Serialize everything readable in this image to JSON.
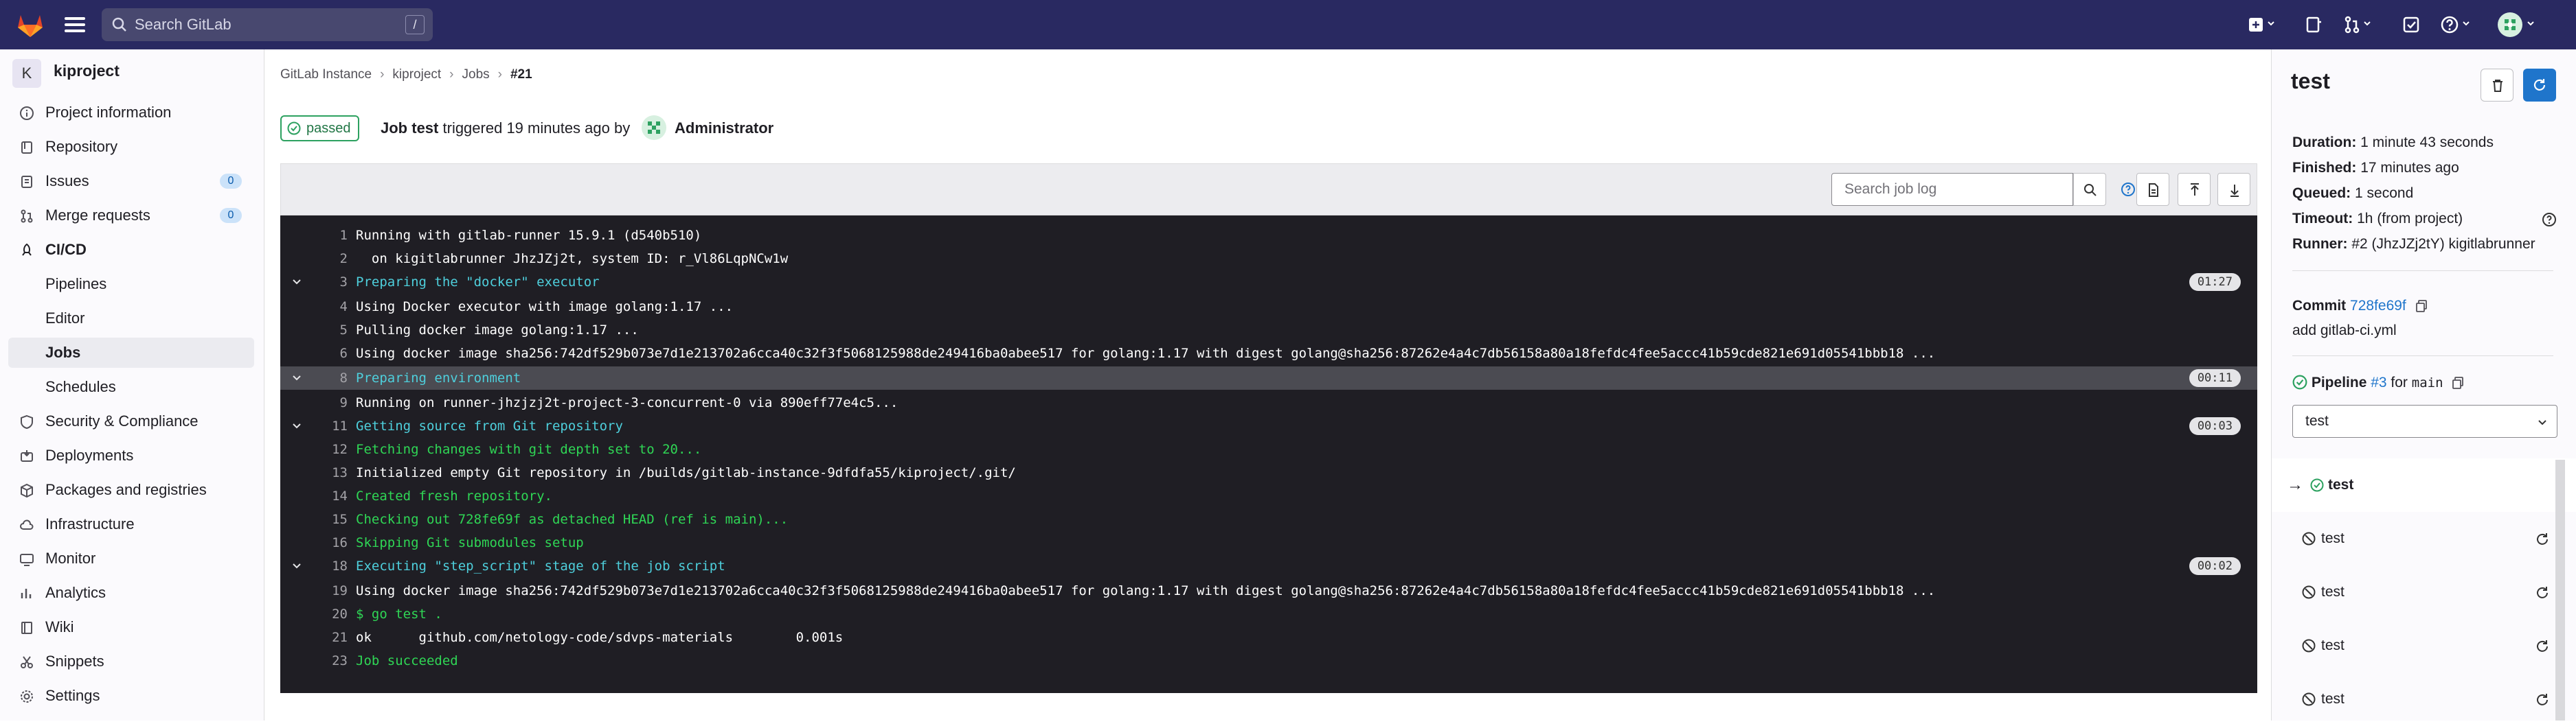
{
  "topbar": {
    "search_placeholder": "Search GitLab",
    "search_shortcut": "/"
  },
  "sidebar": {
    "project_initial": "K",
    "project_name": "kiproject",
    "items": [
      {
        "label": "Project information",
        "icon": "info-icon"
      },
      {
        "label": "Repository",
        "icon": "repository-icon"
      },
      {
        "label": "Issues",
        "icon": "issues-icon",
        "count": "0"
      },
      {
        "label": "Merge requests",
        "icon": "merge-request-icon",
        "count": "0"
      },
      {
        "label": "CI/CD",
        "icon": "rocket-icon"
      },
      {
        "label": "Security & Compliance",
        "icon": "shield-icon"
      },
      {
        "label": "Deployments",
        "icon": "deployments-icon"
      },
      {
        "label": "Packages and registries",
        "icon": "package-icon"
      },
      {
        "label": "Infrastructure",
        "icon": "cloud-icon"
      },
      {
        "label": "Monitor",
        "icon": "monitor-icon"
      },
      {
        "label": "Analytics",
        "icon": "chart-icon"
      },
      {
        "label": "Wiki",
        "icon": "book-icon"
      },
      {
        "label": "Snippets",
        "icon": "snippet-icon"
      },
      {
        "label": "Settings",
        "icon": "gear-icon"
      }
    ],
    "cicd_sub": [
      "Pipelines",
      "Editor",
      "Jobs",
      "Schedules"
    ]
  },
  "breadcrumb": [
    "GitLab Instance",
    "kiproject",
    "Jobs",
    "#21"
  ],
  "job": {
    "status": "passed",
    "headline_prefix": "Job",
    "job_name": "test",
    "triggered": "triggered 19 minutes ago by",
    "user": "Administrator"
  },
  "log_toolbar": {
    "search_placeholder": "Search job log"
  },
  "log": [
    {
      "n": "1",
      "t": "Running with gitlab-runner 15.9.1 (d540b510)",
      "c": ""
    },
    {
      "n": "2",
      "t": "  on kigitlabrunner JhzJZj2t, system ID: r_Vl86LqpNCw1w",
      "c": ""
    },
    {
      "n": "3",
      "t": "Preparing the \"docker\" executor",
      "c": "sec",
      "d": "01:27"
    },
    {
      "n": "4",
      "t": "Using Docker executor with image golang:1.17 ...",
      "c": ""
    },
    {
      "n": "5",
      "t": "Pulling docker image golang:1.17 ...",
      "c": ""
    },
    {
      "n": "6",
      "t": "Using docker image sha256:742df529b073e7d1e213702a6cca40c32f3f5068125988de249416ba0abee517 for golang:1.17 with digest golang@sha256:87262e4a4c7db56158a80a18fefdc4fee5accc41b59cde821e691d05541bbb18 ...",
      "c": ""
    },
    {
      "n": "8",
      "t": "Preparing environment",
      "c": "sec hl",
      "d": "00:11"
    },
    {
      "n": "9",
      "t": "Running on runner-jhzjzj2t-project-3-concurrent-0 via 890eff77e4c5...",
      "c": ""
    },
    {
      "n": "11",
      "t": "Getting source from Git repository",
      "c": "sec",
      "d": "00:03"
    },
    {
      "n": "12",
      "t": "Fetching changes with git depth set to 20...",
      "c": "green"
    },
    {
      "n": "13",
      "t": "Initialized empty Git repository in /builds/gitlab-instance-9dfdfa55/kiproject/.git/",
      "c": ""
    },
    {
      "n": "14",
      "t": "Created fresh repository.",
      "c": "green"
    },
    {
      "n": "15",
      "t": "Checking out 728fe69f as detached HEAD (ref is main)...",
      "c": "green"
    },
    {
      "n": "16",
      "t": "Skipping Git submodules setup",
      "c": "green"
    },
    {
      "n": "18",
      "t": "Executing \"step_script\" stage of the job script",
      "c": "sec",
      "d": "00:02"
    },
    {
      "n": "19",
      "t": "Using docker image sha256:742df529b073e7d1e213702a6cca40c32f3f5068125988de249416ba0abee517 for golang:1.17 with digest golang@sha256:87262e4a4c7db56158a80a18fefdc4fee5accc41b59cde821e691d05541bbb18 ...",
      "c": ""
    },
    {
      "n": "20",
      "t": "$ go test .",
      "c": "green"
    },
    {
      "n": "21",
      "t": "ok  \tgithub.com/netology-code/sdvps-materials\t0.001s",
      "c": ""
    },
    {
      "n": "23",
      "t": "Job succeeded",
      "c": "green"
    }
  ],
  "right": {
    "title": "test",
    "duration_label": "Duration:",
    "duration": "1 minute 43 seconds",
    "finished_label": "Finished:",
    "finished": "17 minutes ago",
    "queued_label": "Queued:",
    "queued": "1 second",
    "timeout_label": "Timeout:",
    "timeout": "1h (from project)",
    "runner_label": "Runner:",
    "runner": "#2 (JhzJZj2tY) kigitlabrunner",
    "commit_label": "Commit",
    "commit_sha": "728fe69f",
    "commit_msg": "add gitlab-ci.yml",
    "pipeline_label": "Pipeline",
    "pipeline_id": "#3",
    "pipeline_for": "for",
    "pipeline_ref": "main",
    "stage": "test",
    "jobs": [
      "test",
      "test",
      "test",
      "test",
      "test"
    ]
  },
  "colors": {
    "topbar": "#292961",
    "success": "#2da160",
    "link": "#1f75cb",
    "log_bg": "#1f1e24",
    "section": "#4ecfdc",
    "green_line": "#2fd655"
  }
}
